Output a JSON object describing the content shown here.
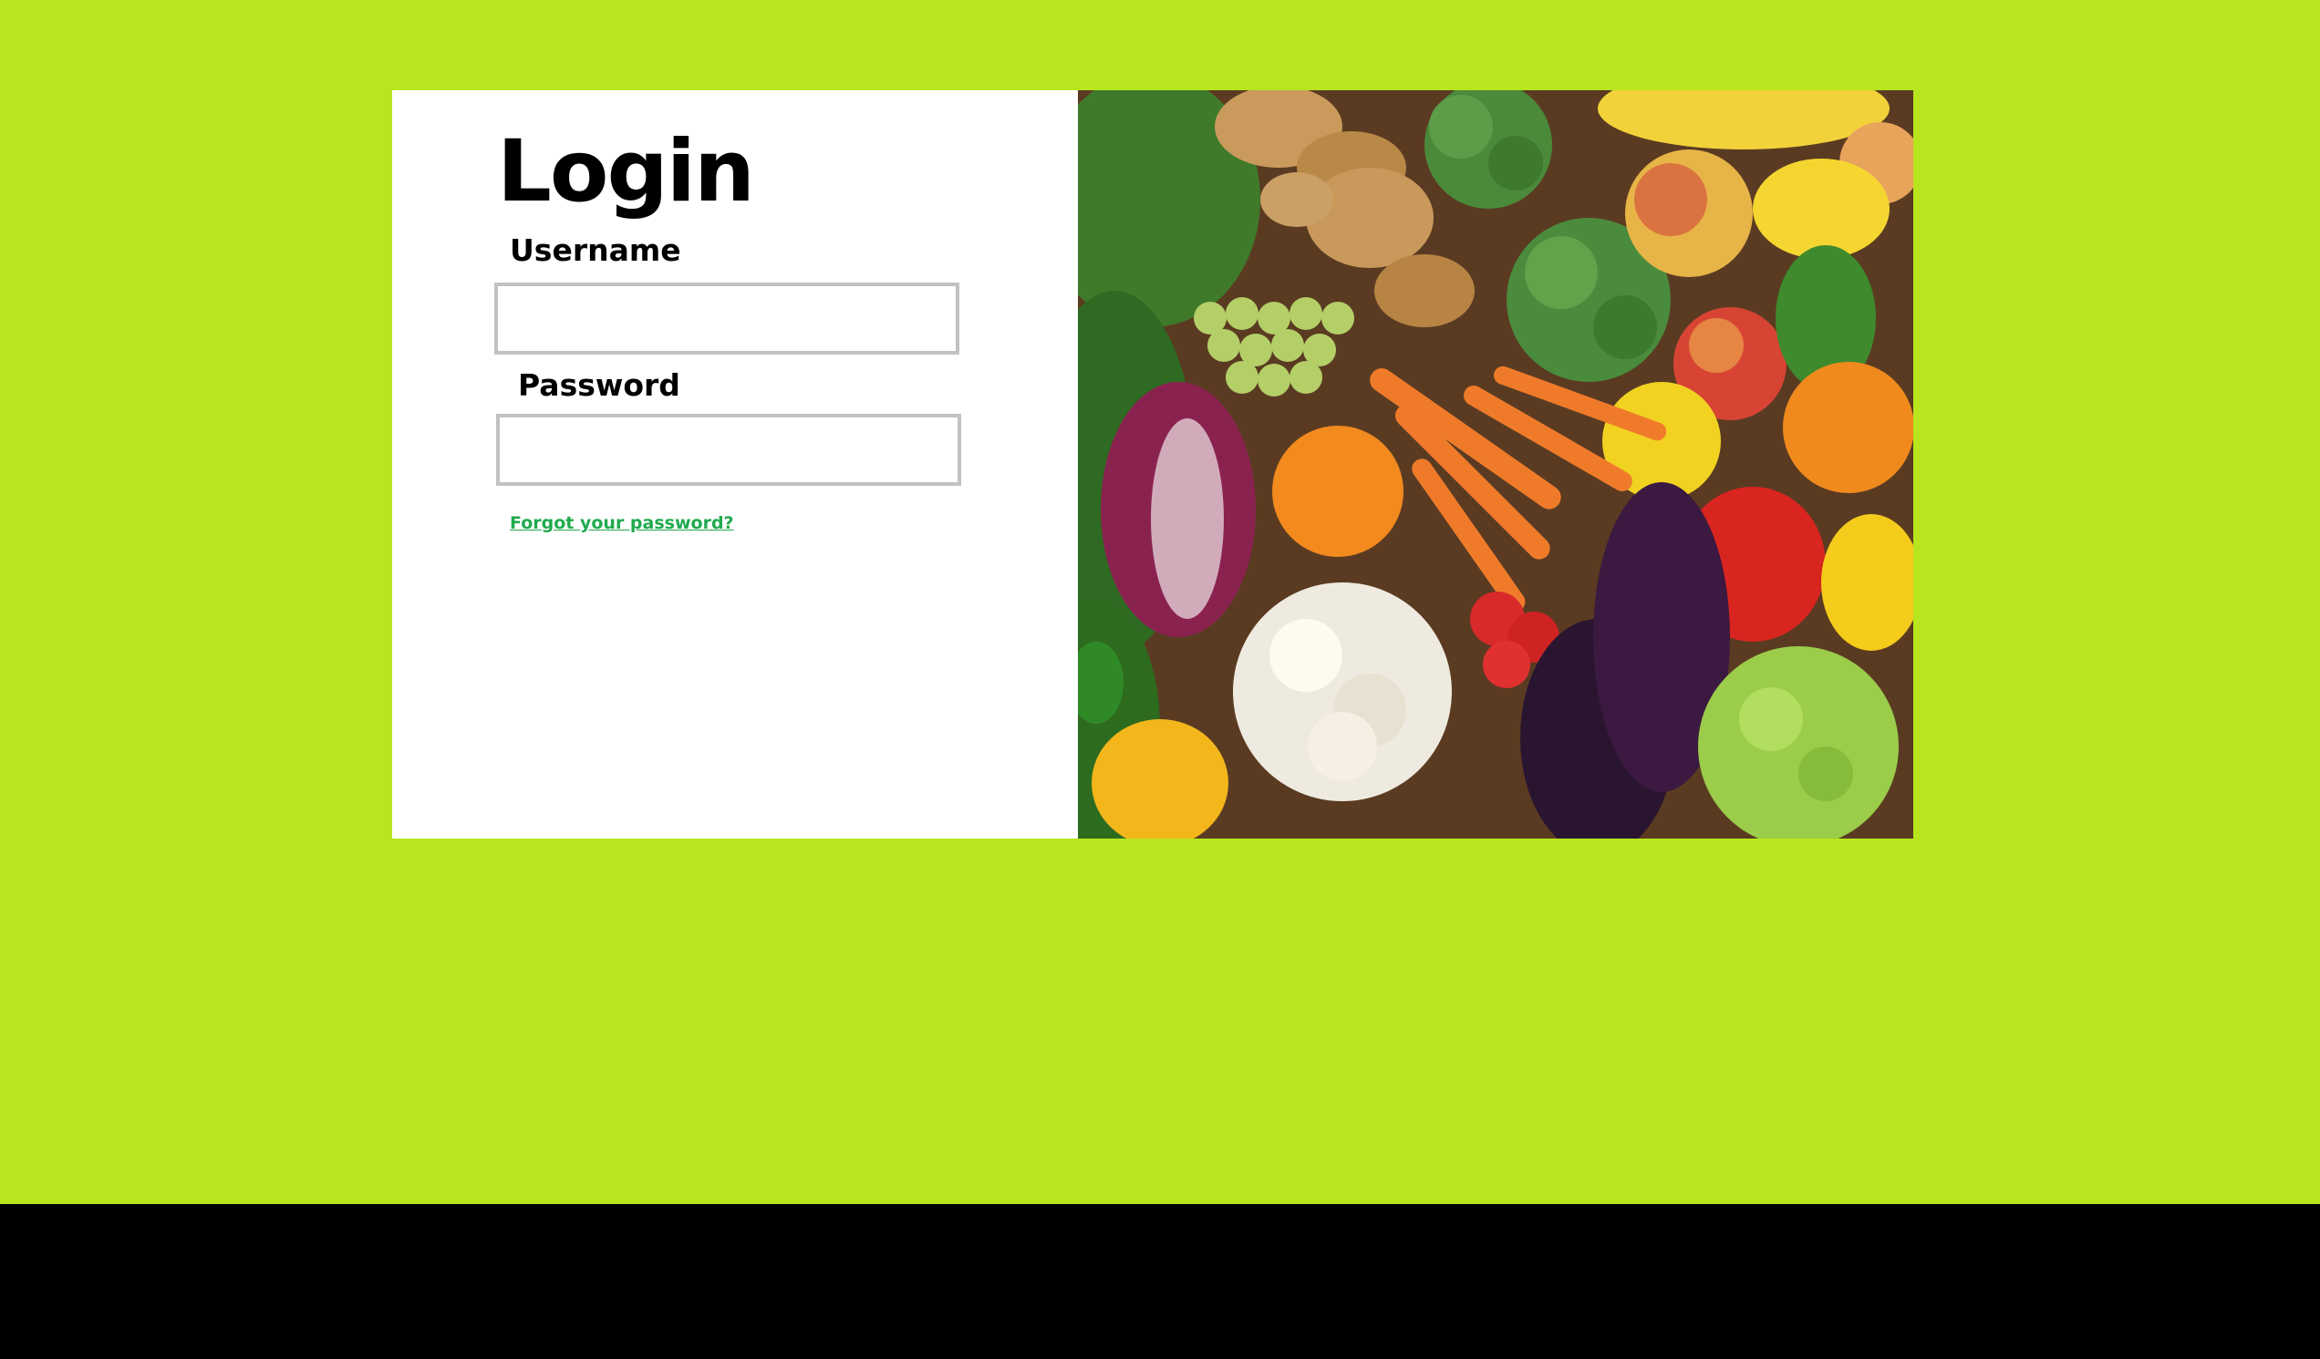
{
  "login": {
    "title": "Login",
    "username_label": "Username",
    "username_value": "",
    "password_label": "Password",
    "password_value": "",
    "forgot_link": "Forgot your password?"
  },
  "image": {
    "alt": "produce-image"
  },
  "colors": {
    "page_background": "#b8e61e",
    "panel_background": "#ffffff",
    "link": "#1faa4e",
    "input_border": "#c2c2c2",
    "footer": "#000000"
  }
}
